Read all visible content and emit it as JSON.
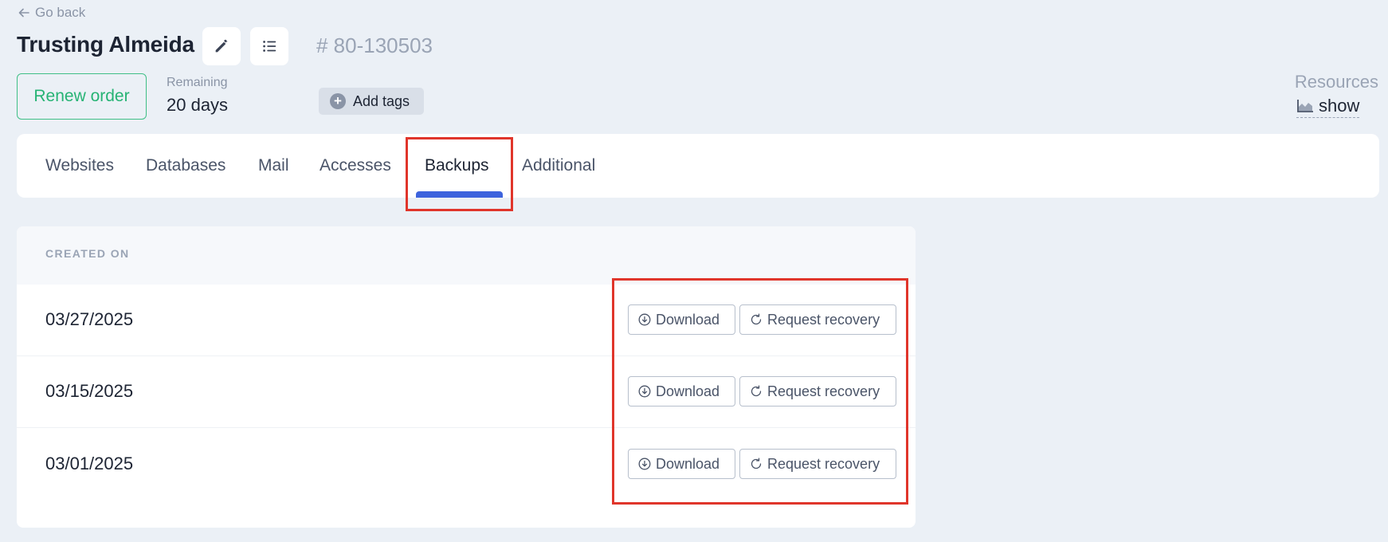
{
  "header": {
    "go_back": "Go back",
    "title": "Trusting Almeida",
    "order_id": "# 80-130503",
    "renew_label": "Renew order",
    "remaining_label": "Remaining",
    "remaining_value": "20 days",
    "add_tags_label": "Add tags",
    "resources_label": "Resources",
    "resources_show": "show"
  },
  "tabs": [
    {
      "label": "Websites",
      "active": false
    },
    {
      "label": "Databases",
      "active": false
    },
    {
      "label": "Mail",
      "active": false
    },
    {
      "label": "Accesses",
      "active": false
    },
    {
      "label": "Backups",
      "active": true
    },
    {
      "label": "Additional",
      "active": false
    }
  ],
  "backups": {
    "column_header": "CREATED ON",
    "download_label": "Download",
    "recovery_label": "Request recovery",
    "rows": [
      {
        "date": "03/27/2025"
      },
      {
        "date": "03/15/2025"
      },
      {
        "date": "03/01/2025"
      }
    ]
  },
  "colors": {
    "accent": "#3d63dd",
    "renew": "#26b374",
    "highlight": "#e0352b",
    "background": "#ebf0f6"
  }
}
